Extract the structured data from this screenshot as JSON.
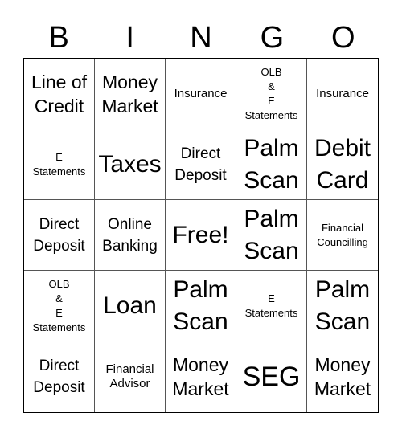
{
  "header": {
    "letters": [
      "B",
      "I",
      "N",
      "G",
      "O"
    ]
  },
  "board": {
    "rows": [
      [
        {
          "text": "Line of\nCredit",
          "size": "l"
        },
        {
          "text": "Money\nMarket",
          "size": "l"
        },
        {
          "text": "Insurance",
          "size": "s"
        },
        {
          "text": "OLB\n&\nE\nStatements",
          "size": "xs"
        },
        {
          "text": "Insurance",
          "size": "s"
        }
      ],
      [
        {
          "text": "E\nStatements",
          "size": "xs"
        },
        {
          "text": "Taxes",
          "size": "xl"
        },
        {
          "text": "Direct\nDeposit",
          "size": "m"
        },
        {
          "text": "Palm\nScan",
          "size": "xl"
        },
        {
          "text": "Debit\nCard",
          "size": "xl"
        }
      ],
      [
        {
          "text": "Direct\nDeposit",
          "size": "m"
        },
        {
          "text": "Online\nBanking",
          "size": "m"
        },
        {
          "text": "Free!",
          "size": "xl"
        },
        {
          "text": "Palm\nScan",
          "size": "xl"
        },
        {
          "text": "Financial\nCouncilling",
          "size": "xs"
        }
      ],
      [
        {
          "text": "OLB\n&\nE\nStatements",
          "size": "xs"
        },
        {
          "text": "Loan",
          "size": "xl"
        },
        {
          "text": "Palm\nScan",
          "size": "xl"
        },
        {
          "text": "E\nStatements",
          "size": "xs"
        },
        {
          "text": "Palm\nScan",
          "size": "xl"
        }
      ],
      [
        {
          "text": "Direct\nDeposit",
          "size": "m"
        },
        {
          "text": "Financial\nAdvisor",
          "size": "s"
        },
        {
          "text": "Money\nMarket",
          "size": "l"
        },
        {
          "text": "SEG",
          "size": "xxl"
        },
        {
          "text": "Money\nMarket",
          "size": "l"
        }
      ]
    ]
  }
}
